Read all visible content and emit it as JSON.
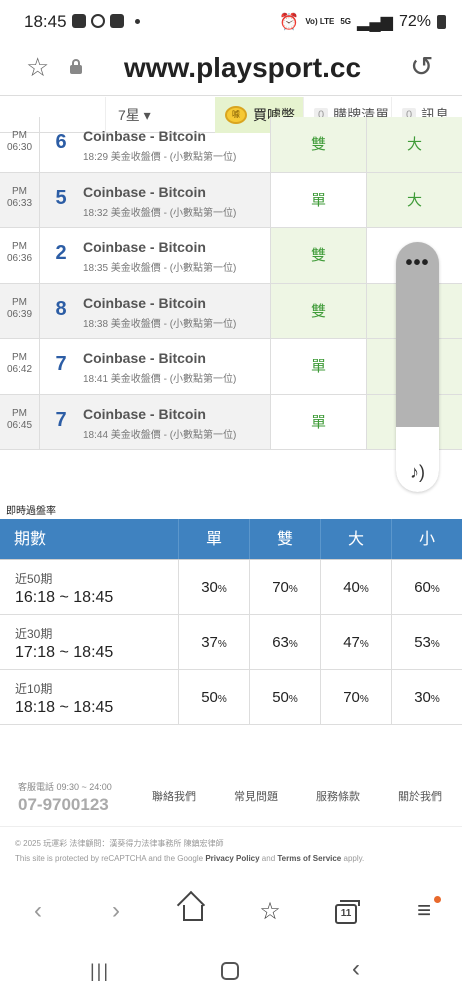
{
  "status_bar": {
    "time": "18:45",
    "network_label": "Vo) LTE",
    "signal_label": "5G",
    "battery": "72%"
  },
  "browser": {
    "url": "www.playsport.cc"
  },
  "subnav": {
    "lottery": "7星 ▾",
    "buy": "買噱幣",
    "cart_count": "0",
    "cart": "購牌清單",
    "msg_count": "0",
    "msg": "訊息",
    "coin_label": "噱"
  },
  "draws": [
    {
      "ampm": "PM",
      "time": "06:30",
      "number": "6",
      "name": "Coinbase - Bitcoin",
      "sub": "18:29 美金收盤價 - (小數點第一位)",
      "c1": "雙",
      "c2": "大"
    },
    {
      "ampm": "PM",
      "time": "06:33",
      "number": "5",
      "name": "Coinbase - Bitcoin",
      "sub": "18:32 美金收盤價 - (小數點第一位)",
      "c1": "單",
      "c2": "大"
    },
    {
      "ampm": "PM",
      "time": "06:36",
      "number": "2",
      "name": "Coinbase - Bitcoin",
      "sub": "18:35 美金收盤價 - (小數點第一位)",
      "c1": "雙",
      "c2": ""
    },
    {
      "ampm": "PM",
      "time": "06:39",
      "number": "8",
      "name": "Coinbase - Bitcoin",
      "sub": "18:38 美金收盤價 - (小數點第一位)",
      "c1": "雙",
      "c2": ""
    },
    {
      "ampm": "PM",
      "time": "06:42",
      "number": "7",
      "name": "Coinbase - Bitcoin",
      "sub": "18:41 美金收盤價 - (小數點第一位)",
      "c1": "單",
      "c2": ""
    },
    {
      "ampm": "PM",
      "time": "06:45",
      "number": "7",
      "name": "Coinbase - Bitcoin",
      "sub": "18:44 美金收盤價 - (小數點第一位)",
      "c1": "單",
      "c2": ""
    }
  ],
  "rate": {
    "label": "即時過盤率",
    "headers": [
      "期數",
      "單",
      "雙",
      "大",
      "小"
    ],
    "rows": [
      {
        "period_label": "近50期",
        "range": "16:18 ~ 18:45",
        "values": [
          "30",
          "70",
          "40",
          "60"
        ]
      },
      {
        "period_label": "近30期",
        "range": "17:18 ~ 18:45",
        "values": [
          "37",
          "63",
          "47",
          "53"
        ]
      },
      {
        "period_label": "近10期",
        "range": "18:18 ~ 18:45",
        "values": [
          "50",
          "50",
          "70",
          "30"
        ]
      }
    ],
    "pct_sign": "%"
  },
  "footer": {
    "service_hours": "客服電話 09:30 ~ 24:00",
    "phone": "07-9700123",
    "links": [
      "聯絡我們",
      "常見問題",
      "服務條款",
      "關於我們"
    ],
    "copyright": "© 2025 玩運彩 法律顧問：漢葵得力法律事務所 陳鎮宏律師",
    "recaptcha_prefix": "This site is protected by reCAPTCHA and the Google ",
    "privacy": "Privacy Policy",
    "and": " and ",
    "terms": "Terms of Service",
    "suffix": " apply."
  },
  "bottom_nav": {
    "tab_count": "11"
  }
}
